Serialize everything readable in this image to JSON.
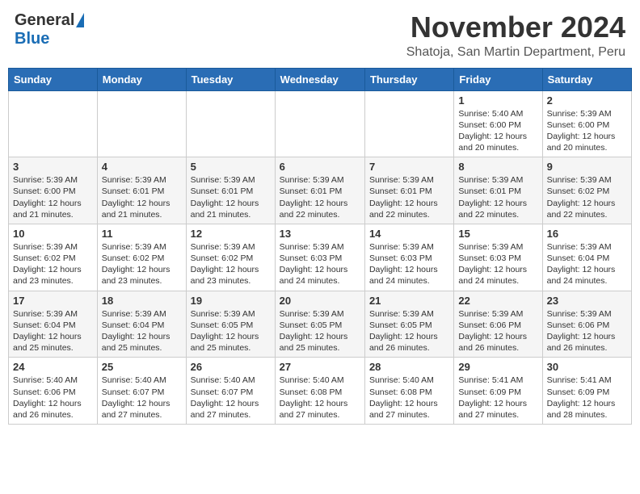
{
  "header": {
    "logo_general": "General",
    "logo_blue": "Blue",
    "month_title": "November 2024",
    "location": "Shatoja, San Martin Department, Peru"
  },
  "days_of_week": [
    "Sunday",
    "Monday",
    "Tuesday",
    "Wednesday",
    "Thursday",
    "Friday",
    "Saturday"
  ],
  "weeks": [
    [
      {
        "day": "",
        "info": ""
      },
      {
        "day": "",
        "info": ""
      },
      {
        "day": "",
        "info": ""
      },
      {
        "day": "",
        "info": ""
      },
      {
        "day": "",
        "info": ""
      },
      {
        "day": "1",
        "info": "Sunrise: 5:40 AM\nSunset: 6:00 PM\nDaylight: 12 hours and 20 minutes."
      },
      {
        "day": "2",
        "info": "Sunrise: 5:39 AM\nSunset: 6:00 PM\nDaylight: 12 hours and 20 minutes."
      }
    ],
    [
      {
        "day": "3",
        "info": "Sunrise: 5:39 AM\nSunset: 6:00 PM\nDaylight: 12 hours and 21 minutes."
      },
      {
        "day": "4",
        "info": "Sunrise: 5:39 AM\nSunset: 6:01 PM\nDaylight: 12 hours and 21 minutes."
      },
      {
        "day": "5",
        "info": "Sunrise: 5:39 AM\nSunset: 6:01 PM\nDaylight: 12 hours and 21 minutes."
      },
      {
        "day": "6",
        "info": "Sunrise: 5:39 AM\nSunset: 6:01 PM\nDaylight: 12 hours and 22 minutes."
      },
      {
        "day": "7",
        "info": "Sunrise: 5:39 AM\nSunset: 6:01 PM\nDaylight: 12 hours and 22 minutes."
      },
      {
        "day": "8",
        "info": "Sunrise: 5:39 AM\nSunset: 6:01 PM\nDaylight: 12 hours and 22 minutes."
      },
      {
        "day": "9",
        "info": "Sunrise: 5:39 AM\nSunset: 6:02 PM\nDaylight: 12 hours and 22 minutes."
      }
    ],
    [
      {
        "day": "10",
        "info": "Sunrise: 5:39 AM\nSunset: 6:02 PM\nDaylight: 12 hours and 23 minutes."
      },
      {
        "day": "11",
        "info": "Sunrise: 5:39 AM\nSunset: 6:02 PM\nDaylight: 12 hours and 23 minutes."
      },
      {
        "day": "12",
        "info": "Sunrise: 5:39 AM\nSunset: 6:02 PM\nDaylight: 12 hours and 23 minutes."
      },
      {
        "day": "13",
        "info": "Sunrise: 5:39 AM\nSunset: 6:03 PM\nDaylight: 12 hours and 24 minutes."
      },
      {
        "day": "14",
        "info": "Sunrise: 5:39 AM\nSunset: 6:03 PM\nDaylight: 12 hours and 24 minutes."
      },
      {
        "day": "15",
        "info": "Sunrise: 5:39 AM\nSunset: 6:03 PM\nDaylight: 12 hours and 24 minutes."
      },
      {
        "day": "16",
        "info": "Sunrise: 5:39 AM\nSunset: 6:04 PM\nDaylight: 12 hours and 24 minutes."
      }
    ],
    [
      {
        "day": "17",
        "info": "Sunrise: 5:39 AM\nSunset: 6:04 PM\nDaylight: 12 hours and 25 minutes."
      },
      {
        "day": "18",
        "info": "Sunrise: 5:39 AM\nSunset: 6:04 PM\nDaylight: 12 hours and 25 minutes."
      },
      {
        "day": "19",
        "info": "Sunrise: 5:39 AM\nSunset: 6:05 PM\nDaylight: 12 hours and 25 minutes."
      },
      {
        "day": "20",
        "info": "Sunrise: 5:39 AM\nSunset: 6:05 PM\nDaylight: 12 hours and 25 minutes."
      },
      {
        "day": "21",
        "info": "Sunrise: 5:39 AM\nSunset: 6:05 PM\nDaylight: 12 hours and 26 minutes."
      },
      {
        "day": "22",
        "info": "Sunrise: 5:39 AM\nSunset: 6:06 PM\nDaylight: 12 hours and 26 minutes."
      },
      {
        "day": "23",
        "info": "Sunrise: 5:39 AM\nSunset: 6:06 PM\nDaylight: 12 hours and 26 minutes."
      }
    ],
    [
      {
        "day": "24",
        "info": "Sunrise: 5:40 AM\nSunset: 6:06 PM\nDaylight: 12 hours and 26 minutes."
      },
      {
        "day": "25",
        "info": "Sunrise: 5:40 AM\nSunset: 6:07 PM\nDaylight: 12 hours and 27 minutes."
      },
      {
        "day": "26",
        "info": "Sunrise: 5:40 AM\nSunset: 6:07 PM\nDaylight: 12 hours and 27 minutes."
      },
      {
        "day": "27",
        "info": "Sunrise: 5:40 AM\nSunset: 6:08 PM\nDaylight: 12 hours and 27 minutes."
      },
      {
        "day": "28",
        "info": "Sunrise: 5:40 AM\nSunset: 6:08 PM\nDaylight: 12 hours and 27 minutes."
      },
      {
        "day": "29",
        "info": "Sunrise: 5:41 AM\nSunset: 6:09 PM\nDaylight: 12 hours and 27 minutes."
      },
      {
        "day": "30",
        "info": "Sunrise: 5:41 AM\nSunset: 6:09 PM\nDaylight: 12 hours and 28 minutes."
      }
    ]
  ]
}
